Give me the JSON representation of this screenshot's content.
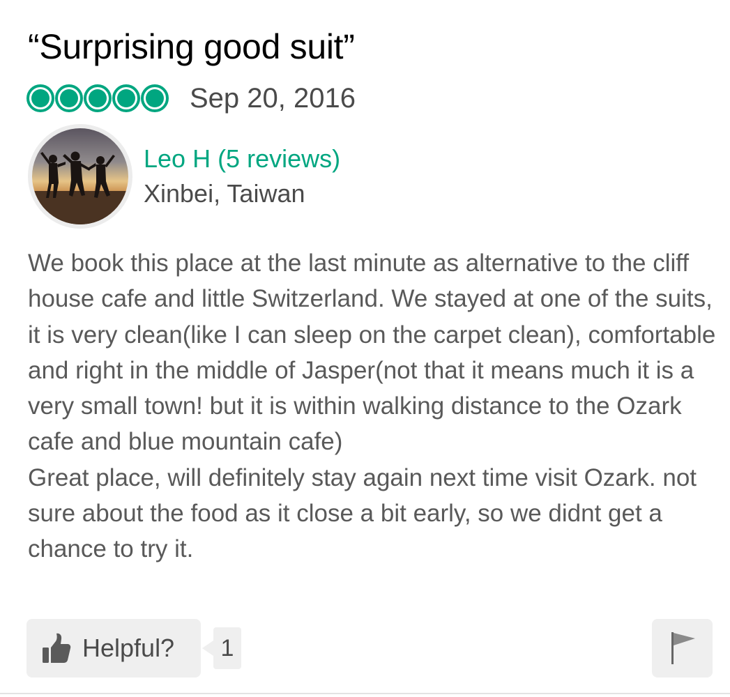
{
  "review": {
    "title": "“Surprising good suit”",
    "rating": {
      "value": 5,
      "max": 5,
      "color": "#00a680"
    },
    "date": "Sep 20, 2016",
    "user": {
      "name_label": "Leo H (5 reviews)",
      "location": "Xinbei, Taiwan"
    },
    "body": [
      "We book this place at the last minute as alternative to the cliff house cafe and little Switzerland. We stayed at one of the suits, it is very clean(like I can sleep on the carpet clean), comfortable and right in the middle of Jasper(not that it means much it is a very small town! but it is within walking distance to the Ozark cafe and blue mountain cafe)",
      "Great place, will definitely stay again next time visit Ozark. not sure about the food as it close a bit early, so we didnt get a chance to try it."
    ],
    "helpful": {
      "label": "Helpful?",
      "count": "1"
    }
  },
  "icons": {
    "rating": "bubble-rating-icon",
    "helpful": "thumbs-up-icon",
    "report": "flag-icon"
  }
}
